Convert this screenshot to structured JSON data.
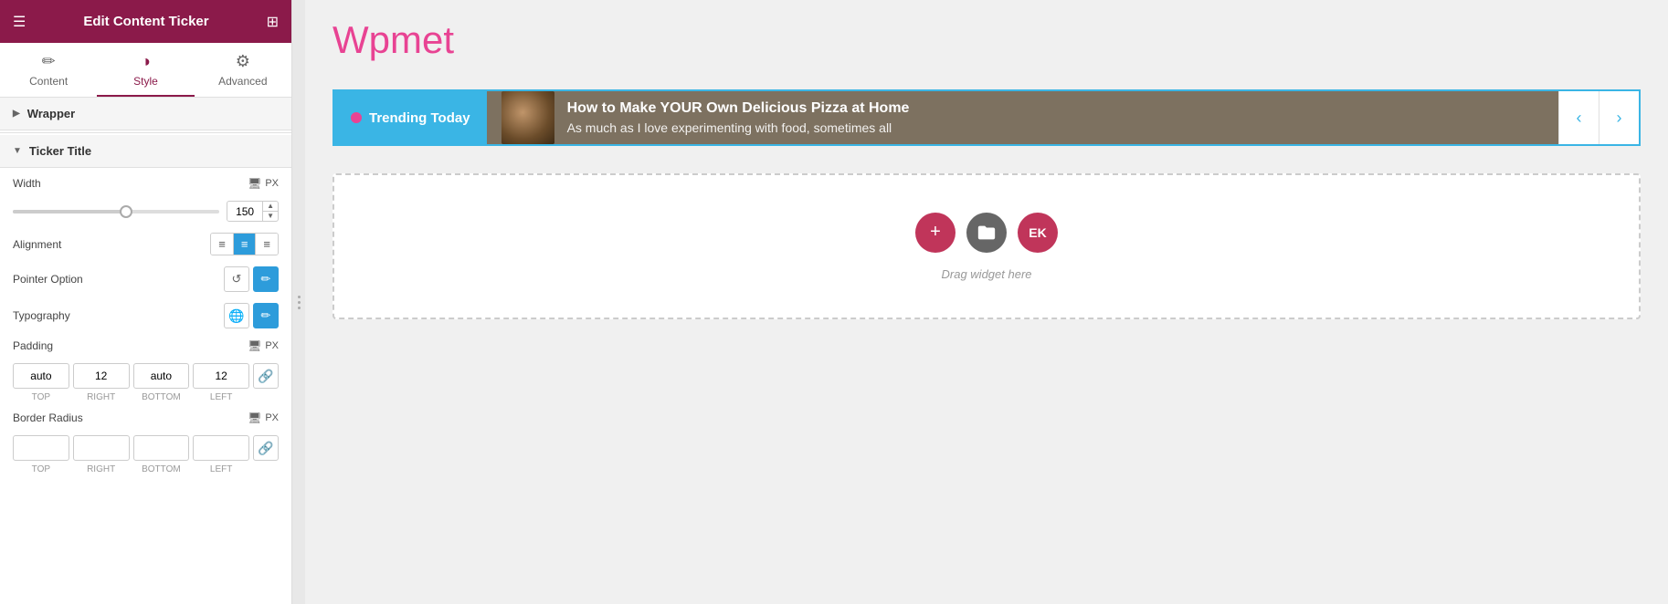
{
  "header": {
    "title": "Edit Content Ticker",
    "menu_icon": "☰",
    "grid_icon": "⊞"
  },
  "tabs": [
    {
      "id": "content",
      "label": "Content",
      "icon": "✏️",
      "active": false
    },
    {
      "id": "style",
      "label": "Style",
      "icon": "🎨",
      "active": true
    },
    {
      "id": "advanced",
      "label": "Advanced",
      "icon": "⚙️",
      "active": false
    }
  ],
  "sections": {
    "wrapper": {
      "label": "Wrapper",
      "collapsed": true
    },
    "ticker_title": {
      "label": "Ticker Title",
      "collapsed": false,
      "width": {
        "label": "Width",
        "value": 150,
        "unit": "PX"
      },
      "alignment": {
        "label": "Alignment",
        "options": [
          "left",
          "center",
          "right"
        ],
        "active": "center"
      },
      "pointer_option": {
        "label": "Pointer Option"
      },
      "typography": {
        "label": "Typography"
      },
      "padding": {
        "label": "Padding",
        "unit": "PX",
        "top": "auto",
        "right": "12",
        "bottom": "auto",
        "left": "12"
      },
      "border_radius": {
        "label": "Border Radius",
        "unit": "PX"
      }
    }
  },
  "ticker": {
    "label": "Trending Today",
    "title": "How to Make YOUR Own Delicious Pizza at Home",
    "subtitle": "As much as I love experimenting with food, sometimes all",
    "prev_icon": "‹",
    "next_icon": "›"
  },
  "drop_zone": {
    "text": "Drag widget here",
    "btn_plus": "+",
    "btn_folder": "⊞",
    "btn_ek": "EK"
  },
  "colors": {
    "brand_dark": "#8b1a4a",
    "accent_blue": "#3ab5e5",
    "accent_pink": "#e84393"
  }
}
